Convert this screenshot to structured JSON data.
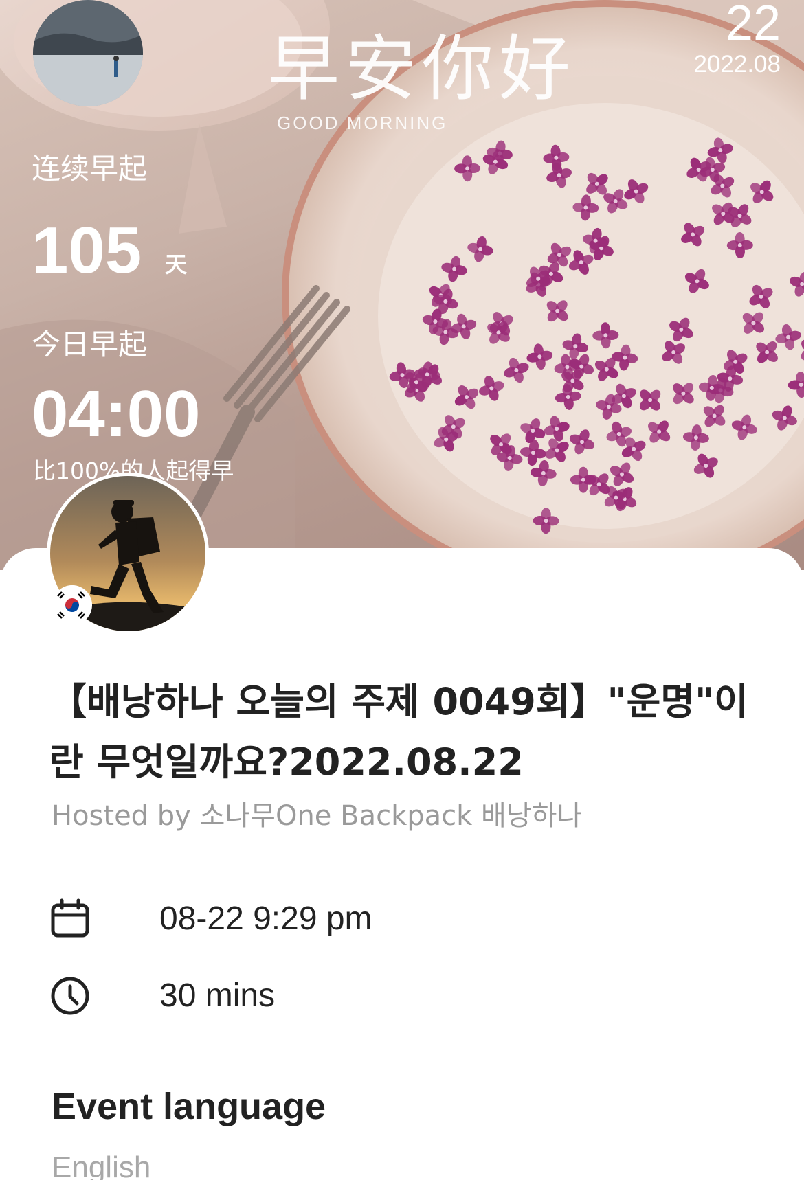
{
  "hero": {
    "date_day": "22",
    "date_year_month": "2022.08",
    "greeting": "早安你好",
    "greeting_sub": "GOOD MORNING",
    "streak_label": "连续早起",
    "streak_value": "105",
    "streak_unit": "天",
    "today_label": "今日早起",
    "wake_time": "04:00",
    "compare_text": "比100%的人起得早"
  },
  "event": {
    "title": "【배낭하나 오늘의 주제 0049회】\"운명\"이란 무엇일까요?2022.08.22",
    "hosted_by": "Hosted by 소나무One Backpack 배낭하나",
    "datetime": "08-22 9:29 pm",
    "duration": "30 mins",
    "language_heading": "Event language",
    "language_value": "English"
  },
  "icons": {
    "calendar": "calendar-icon",
    "duration": "clock-icon",
    "flag": "south-korea-flag-icon"
  },
  "colors": {
    "sheet": "#ffffff",
    "text_primary": "#222222",
    "text_secondary": "#9a9a9a",
    "flower_accent": "#9b2d78"
  }
}
